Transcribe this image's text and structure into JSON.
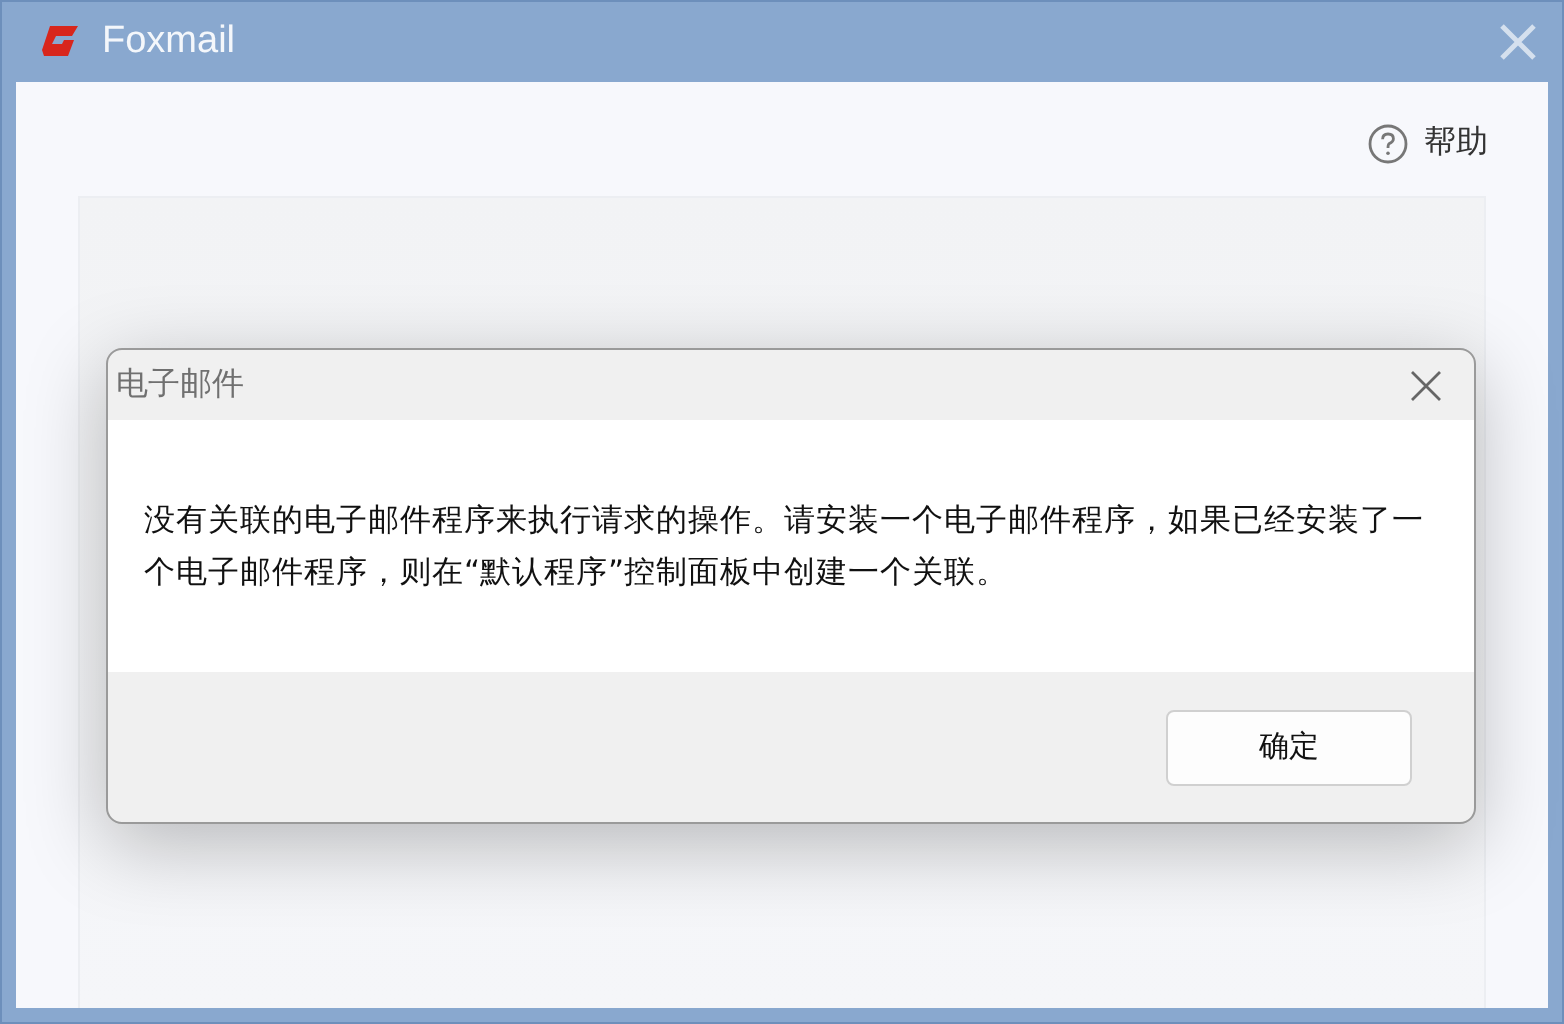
{
  "window": {
    "title": "Foxmail"
  },
  "help": {
    "label": "帮助"
  },
  "dialog": {
    "title": "电子邮件",
    "message": "没有关联的电子邮件程序来执行请求的操作。请安装一个电子邮件程序，如果已经安装了一个电子邮件程序，则在“默认程序”控制面板中创建一个关联。",
    "buttons": [
      "确定"
    ]
  }
}
